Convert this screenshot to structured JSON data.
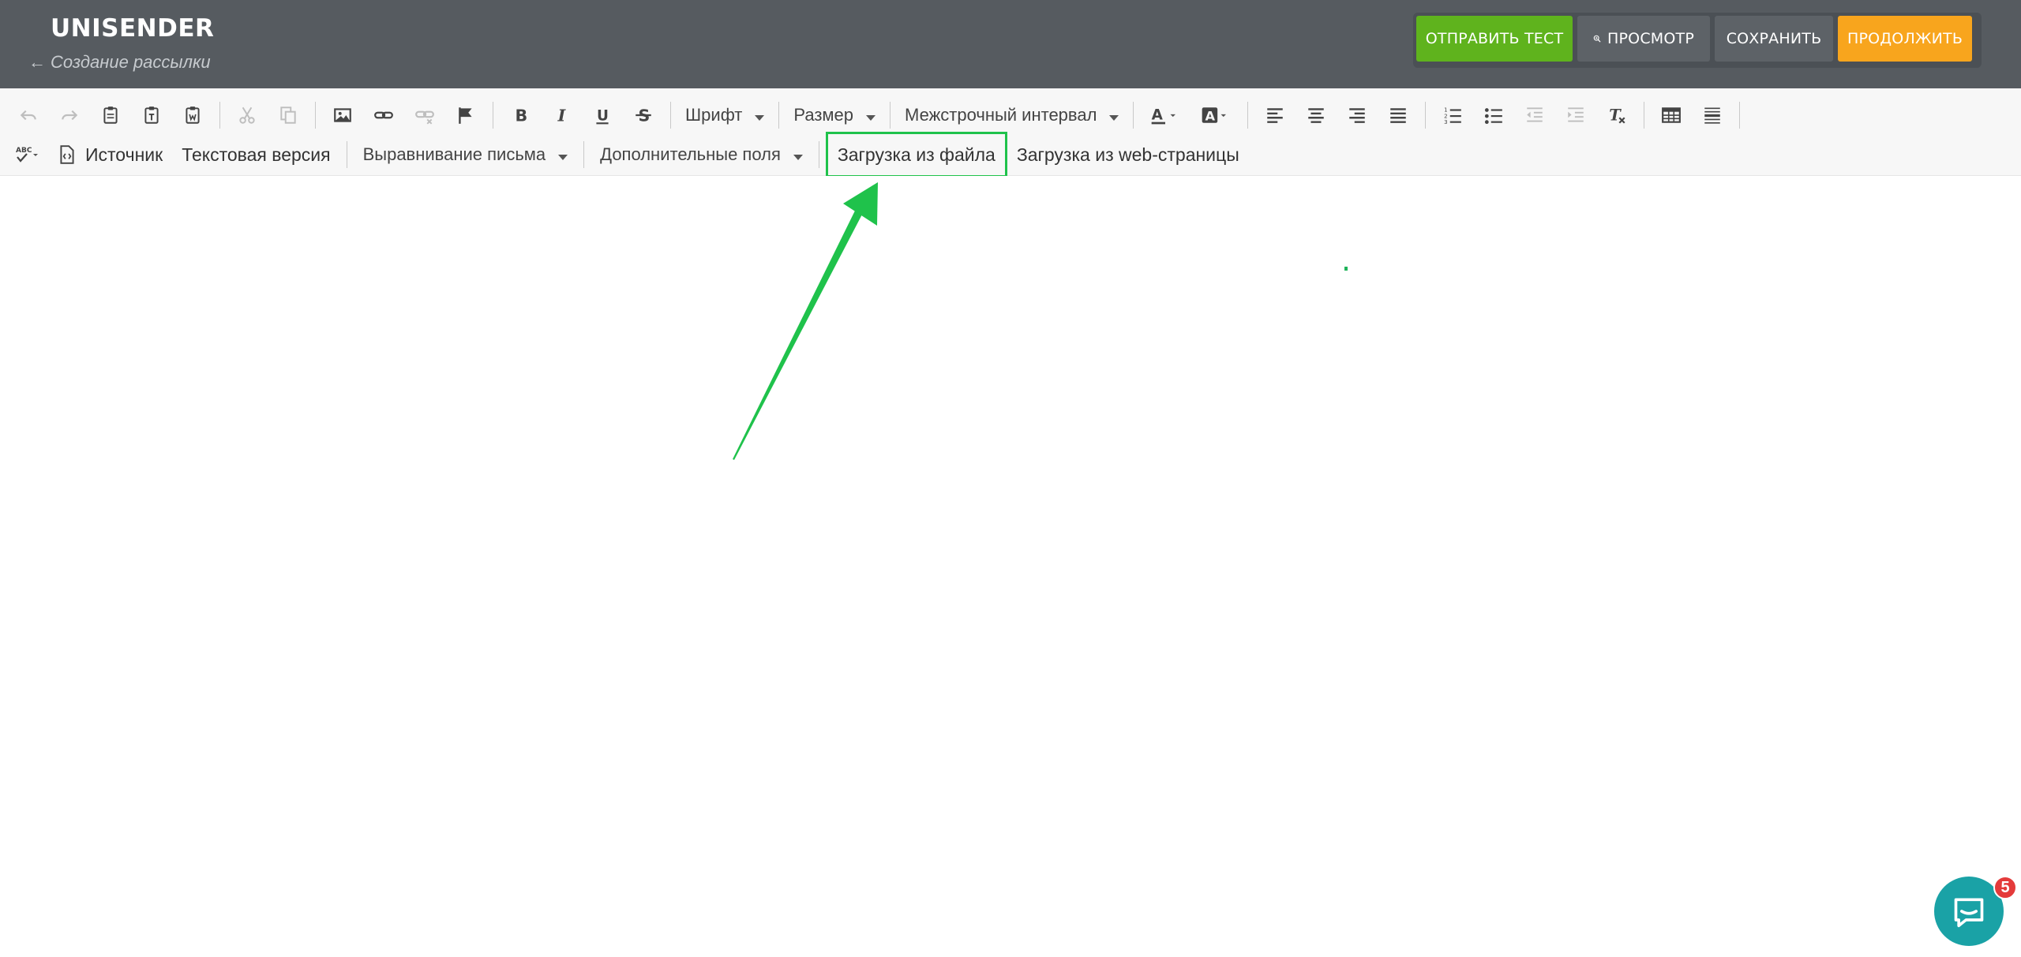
{
  "header": {
    "logo": "UNISENDER",
    "back_arrow": "←",
    "back_label": "Создание рассылки",
    "buttons": {
      "send_test": "ОТПРАВИТЬ ТЕСТ",
      "preview": "ПРОСМОТР",
      "save": "СОХРАНИТЬ",
      "continue": "ПРОДОЛЖИТЬ"
    }
  },
  "toolbar": {
    "font": "Шрифт",
    "size": "Размер",
    "line_spacing": "Межстрочный интервал",
    "source": "Источник",
    "text_version": "Текстовая версия",
    "letter_alignment": "Выравнивание письма",
    "extra_fields": "Дополнительные поля",
    "load_from_file": "Загрузка из файла",
    "load_from_web": "Загрузка из web-страницы",
    "spellcheck_label": "ABC"
  },
  "chat": {
    "badge_count": "5"
  },
  "colors": {
    "header_bg": "#565b60",
    "green_button": "#5fb31d",
    "orange_button": "#f8a51d",
    "highlight": "#1fc24b",
    "chat": "#1aa2a6",
    "badge": "#e43b3b"
  }
}
